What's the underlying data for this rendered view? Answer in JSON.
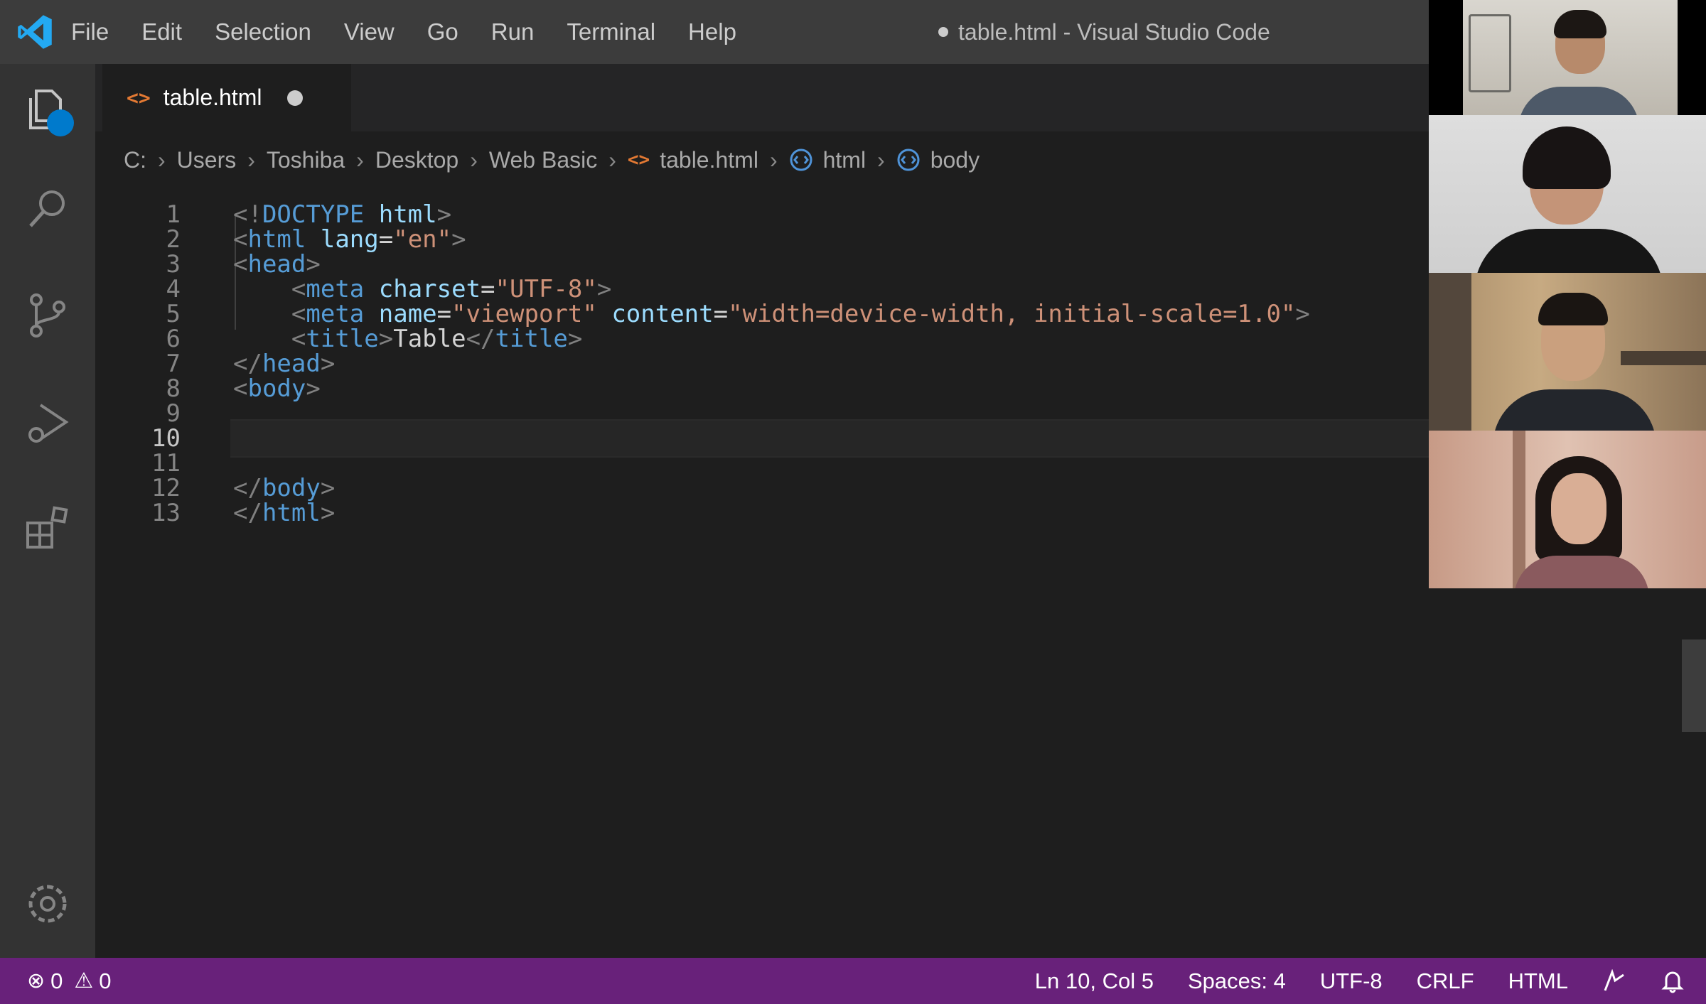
{
  "window": {
    "title": "table.html - Visual Studio Code"
  },
  "menu": [
    "File",
    "Edit",
    "Selection",
    "View",
    "Go",
    "Run",
    "Terminal",
    "Help"
  ],
  "activity_bar": {
    "items": [
      {
        "icon": "files-icon"
      },
      {
        "icon": "search-icon"
      },
      {
        "icon": "source-control-icon"
      },
      {
        "icon": "run-debug-icon"
      },
      {
        "icon": "extensions-icon"
      }
    ],
    "settings_icon": "gear-icon",
    "accent": "#007acc"
  },
  "tab": {
    "file_icon": "<>",
    "label": "table.html"
  },
  "breadcrumb": {
    "parts": [
      "C:",
      "Users",
      "Toshiba",
      "Desktop",
      "Web Basic"
    ],
    "file_icon": "<>",
    "file": "table.html",
    "html": "html",
    "body": "body"
  },
  "code": {
    "lines": [
      {
        "n": "1",
        "tokens": [
          [
            "br",
            "<!"
          ],
          [
            "tag",
            "DOCTYPE"
          ],
          [
            "txt",
            " "
          ],
          [
            "attr",
            "html"
          ],
          [
            "br",
            ">"
          ]
        ]
      },
      {
        "n": "2",
        "tokens": [
          [
            "br",
            "<"
          ],
          [
            "tag",
            "html"
          ],
          [
            "txt",
            " "
          ],
          [
            "attr",
            "lang"
          ],
          [
            "eq",
            "="
          ],
          [
            "str",
            "\"en\""
          ],
          [
            "br",
            ">"
          ]
        ]
      },
      {
        "n": "3",
        "tokens": [
          [
            "br",
            "<"
          ],
          [
            "tag",
            "head"
          ],
          [
            "br",
            ">"
          ]
        ]
      },
      {
        "n": "4",
        "tokens": [
          [
            "txt",
            "    "
          ],
          [
            "br",
            "<"
          ],
          [
            "tag",
            "meta"
          ],
          [
            "txt",
            " "
          ],
          [
            "attr",
            "charset"
          ],
          [
            "eq",
            "="
          ],
          [
            "str",
            "\"UTF-8\""
          ],
          [
            "br",
            ">"
          ]
        ]
      },
      {
        "n": "5",
        "tokens": [
          [
            "txt",
            "    "
          ],
          [
            "br",
            "<"
          ],
          [
            "tag",
            "meta"
          ],
          [
            "txt",
            " "
          ],
          [
            "attr",
            "name"
          ],
          [
            "eq",
            "="
          ],
          [
            "str",
            "\"viewport\""
          ],
          [
            "txt",
            " "
          ],
          [
            "attr",
            "content"
          ],
          [
            "eq",
            "="
          ],
          [
            "str",
            "\"width=device-width, initial-scale=1.0\""
          ],
          [
            "br",
            ">"
          ]
        ]
      },
      {
        "n": "6",
        "tokens": [
          [
            "txt",
            "    "
          ],
          [
            "br",
            "<"
          ],
          [
            "tag",
            "title"
          ],
          [
            "br",
            ">"
          ],
          [
            "txt",
            "Table"
          ],
          [
            "br",
            "</"
          ],
          [
            "tag",
            "title"
          ],
          [
            "br",
            ">"
          ]
        ]
      },
      {
        "n": "7",
        "tokens": [
          [
            "br",
            "</"
          ],
          [
            "tag",
            "head"
          ],
          [
            "br",
            ">"
          ]
        ]
      },
      {
        "n": "8",
        "tokens": [
          [
            "br",
            "<"
          ],
          [
            "tag",
            "body"
          ],
          [
            "br",
            ">"
          ]
        ]
      },
      {
        "n": "9",
        "tokens": []
      },
      {
        "n": "10",
        "tokens": []
      },
      {
        "n": "11",
        "tokens": []
      },
      {
        "n": "12",
        "tokens": [
          [
            "br",
            "</"
          ],
          [
            "tag",
            "body"
          ],
          [
            "br",
            ">"
          ]
        ]
      },
      {
        "n": "13",
        "tokens": [
          [
            "br",
            "</"
          ],
          [
            "tag",
            "html"
          ],
          [
            "br",
            ">"
          ]
        ]
      }
    ],
    "current_line": 10
  },
  "status": {
    "errors": "0",
    "warnings": "0",
    "cursor": "Ln 10, Col 5",
    "spaces": "Spaces: 4",
    "encoding": "UTF-8",
    "eol": "CRLF",
    "language": "HTML",
    "color": "#68217a"
  },
  "participants": [
    {
      "tile": "video-participant-1"
    },
    {
      "tile": "video-participant-2"
    },
    {
      "tile": "video-participant-3"
    },
    {
      "tile": "video-participant-4"
    }
  ]
}
